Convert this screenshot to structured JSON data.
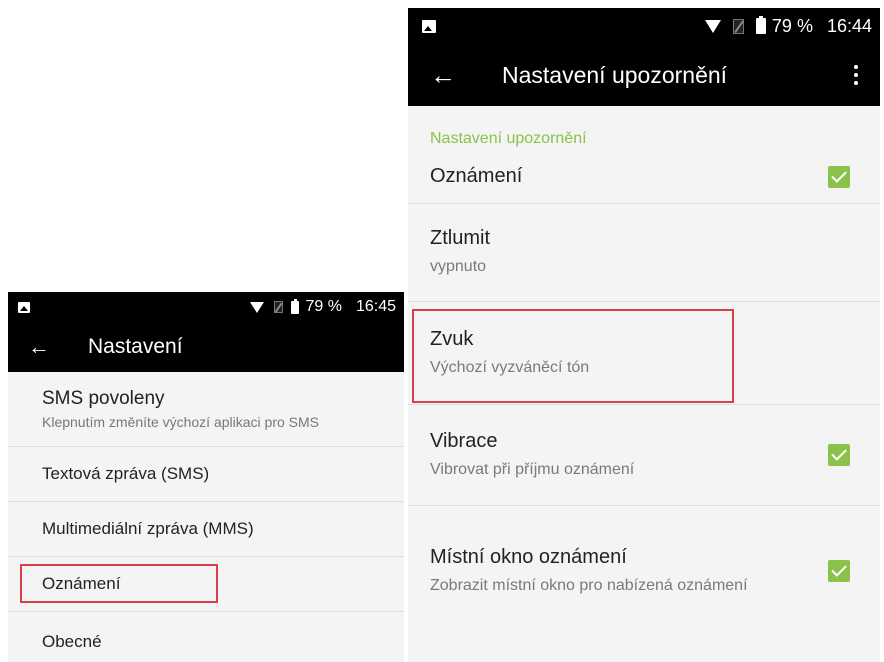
{
  "left_screen": {
    "status_bar": {
      "gallery_icon": "image-icon",
      "wifi_icon": "wifi-icon",
      "sim_icon": "no-sim-icon",
      "battery_icon": "battery-icon",
      "battery": "79 %",
      "time": "16:45"
    },
    "app_bar": {
      "back_icon": "arrow-back-icon",
      "title": "Nastavení"
    },
    "items": [
      {
        "title": "SMS povoleny",
        "subtitle": "Klepnutím změníte výchozí aplikaci pro SMS"
      },
      {
        "title": "Textová zpráva (SMS)"
      },
      {
        "title": "Multimediální zpráva (MMS)"
      },
      {
        "title": "Oznámení",
        "highlighted": true
      },
      {
        "title": "Obecné"
      }
    ]
  },
  "right_screen": {
    "status_bar": {
      "gallery_icon": "image-icon",
      "wifi_icon": "wifi-icon",
      "sim_icon": "no-sim-icon",
      "battery_icon": "battery-icon",
      "battery": "79 %",
      "time": "16:44"
    },
    "app_bar": {
      "back_icon": "arrow-back-icon",
      "title": "Nastavení upozornění",
      "menu_icon": "overflow-menu-icon"
    },
    "section_header": "Nastavení upozornění",
    "items": [
      {
        "title": "Oznámení",
        "checked": true
      },
      {
        "title": "Ztlumit",
        "subtitle": "vypnuto"
      },
      {
        "title": "Zvuk",
        "subtitle": "Výchozí vyzváněcí tón",
        "highlighted": true
      },
      {
        "title": "Vibrace",
        "subtitle": "Vibrovat při příjmu oznámení",
        "checked": true
      },
      {
        "title": "Místní okno oznámení",
        "subtitle": "Zobrazit místní okno pro nabízená oznámení",
        "checked": true
      }
    ]
  },
  "colors": {
    "accent_green": "#8bc34a",
    "highlight_red": "#d9404a",
    "bar_black": "#000000"
  }
}
